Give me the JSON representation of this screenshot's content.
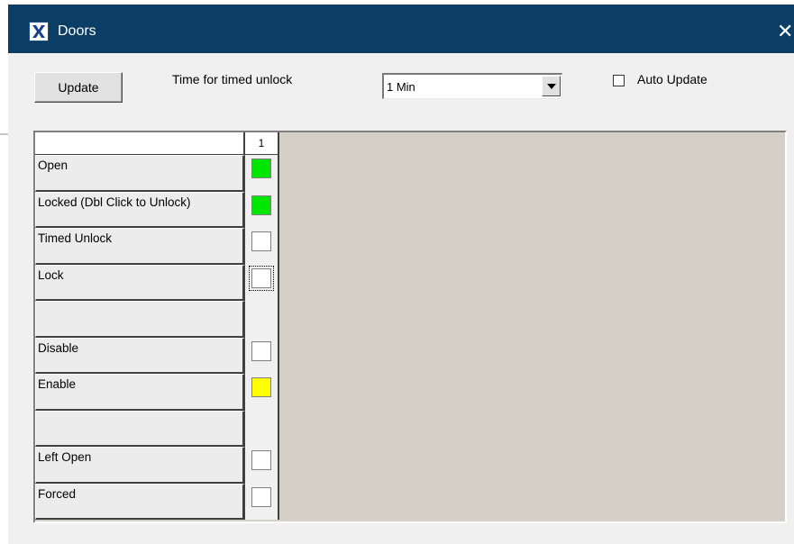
{
  "window": {
    "title": "Doors",
    "close_glyph": "✕",
    "titlebar_color": "#0b3d65"
  },
  "toolbar": {
    "update_label": "Update",
    "time_label": "Time for timed unlock",
    "time_value": "1 Min",
    "auto_update_label": "Auto Update",
    "auto_update_checked": false
  },
  "grid": {
    "column_header": "1",
    "rows": [
      {
        "label": "Open",
        "state_color": "#00e600"
      },
      {
        "label": "Locked (Dbl Click to Unlock)",
        "state_color": "#00e600"
      },
      {
        "label": "Timed Unlock",
        "state_color": "#ffffff"
      },
      {
        "label": "Lock",
        "state_color": "#ffffff"
      },
      {
        "label": "",
        "state_color": null
      },
      {
        "label": "Disable",
        "state_color": "#ffffff"
      },
      {
        "label": "Enable",
        "state_color": "#ffff00"
      },
      {
        "label": "",
        "state_color": null
      },
      {
        "label": "Left Open",
        "state_color": "#ffffff"
      },
      {
        "label": "Forced",
        "state_color": "#ffffff"
      }
    ]
  },
  "icons": {
    "app": "app-x-icon",
    "close": "close-icon",
    "dropdown": "chevron-down-icon"
  }
}
